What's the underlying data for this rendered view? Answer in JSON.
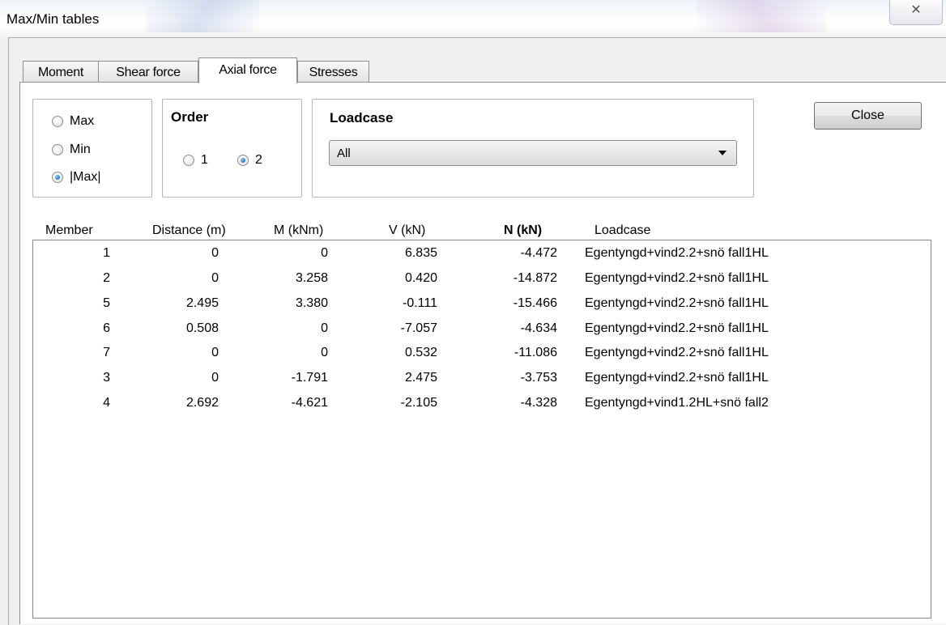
{
  "window": {
    "title": "Max/Min tables",
    "close_glyph": "✕"
  },
  "tabs": [
    {
      "label": "Moment",
      "active": false
    },
    {
      "label": "Shear force",
      "active": false
    },
    {
      "label": "Axial force",
      "active": true
    },
    {
      "label": "Stresses",
      "active": false
    }
  ],
  "mode": {
    "options": [
      {
        "label": "Max",
        "checked": false
      },
      {
        "label": "Min",
        "checked": false
      },
      {
        "label": "|Max|",
        "checked": true
      }
    ]
  },
  "order": {
    "title": "Order",
    "options": [
      {
        "label": "1",
        "checked": false
      },
      {
        "label": "2",
        "checked": true
      }
    ]
  },
  "loadcase": {
    "title": "Loadcase",
    "selected": "All"
  },
  "close_button": {
    "label": "Close"
  },
  "table": {
    "columns": [
      "Member",
      "Distance (m)",
      "M (kNm)",
      "V (kN)",
      "N (kN)",
      "Loadcase"
    ],
    "sorted_column": "N (kN)",
    "rows": [
      {
        "member": "1",
        "distance": "0",
        "m": "0",
        "v": "6.835",
        "n": "-4.472",
        "loadcase": "Egentyngd+vind2.2+snö fall1HL"
      },
      {
        "member": "2",
        "distance": "0",
        "m": "3.258",
        "v": "0.420",
        "n": "-14.872",
        "loadcase": "Egentyngd+vind2.2+snö fall1HL"
      },
      {
        "member": "5",
        "distance": "2.495",
        "m": "3.380",
        "v": "-0.111",
        "n": "-15.466",
        "loadcase": "Egentyngd+vind2.2+snö fall1HL"
      },
      {
        "member": "6",
        "distance": "0.508",
        "m": "0",
        "v": "-7.057",
        "n": "-4.634",
        "loadcase": "Egentyngd+vind2.2+snö fall1HL"
      },
      {
        "member": "7",
        "distance": "0",
        "m": "0",
        "v": "0.532",
        "n": "-11.086",
        "loadcase": "Egentyngd+vind2.2+snö fall1HL"
      },
      {
        "member": "3",
        "distance": "0",
        "m": "-1.791",
        "v": "2.475",
        "n": "-3.753",
        "loadcase": "Egentyngd+vind2.2+snö fall1HL"
      },
      {
        "member": "4",
        "distance": "2.692",
        "m": "-4.621",
        "v": "-2.105",
        "n": "-4.328",
        "loadcase": "Egentyngd+vind1.2HL+snö fall2"
      }
    ]
  }
}
